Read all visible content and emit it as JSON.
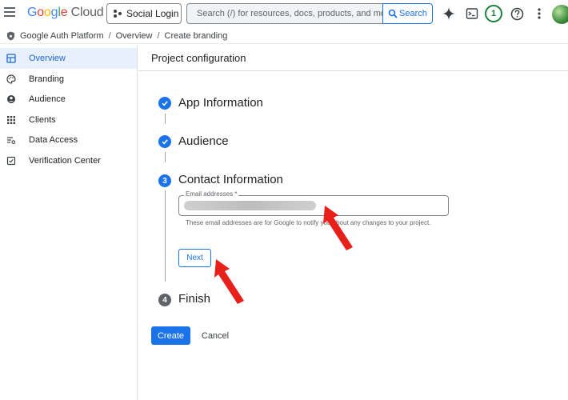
{
  "header": {
    "logo_google": "Google",
    "logo_cloud": "Cloud",
    "project_name": "Social Login",
    "search_placeholder": "Search (/) for resources, docs, products, and more",
    "search_button": "Search",
    "notifications_count": "1"
  },
  "breadcrumb": [
    "Google Auth Platform",
    "Overview",
    "Create branding"
  ],
  "sidebar": {
    "items": [
      {
        "label": "Overview",
        "icon": "dashboard-icon",
        "active": true
      },
      {
        "label": "Branding",
        "icon": "palette-icon",
        "active": false
      },
      {
        "label": "Audience",
        "icon": "person-icon",
        "active": false
      },
      {
        "label": "Clients",
        "icon": "grid-icon",
        "active": false
      },
      {
        "label": "Data Access",
        "icon": "data-access-icon",
        "active": false
      },
      {
        "label": "Verification Center",
        "icon": "verified-icon",
        "active": false
      }
    ]
  },
  "main": {
    "title": "Project configuration",
    "steps": [
      {
        "title": "App Information",
        "state": "done"
      },
      {
        "title": "Audience",
        "state": "done"
      },
      {
        "title": "Contact Information",
        "state": "current",
        "number": "3"
      },
      {
        "title": "Finish",
        "state": "pending",
        "number": "4"
      }
    ],
    "email_field": {
      "label": "Email addresses *",
      "helper": "These email addresses are for Google to notify you about any changes to your project."
    },
    "next_button": "Next",
    "create_button": "Create",
    "cancel_button": "Cancel"
  },
  "colors": {
    "accent": "#1a73e8",
    "annotation_arrow": "#e8201a"
  }
}
